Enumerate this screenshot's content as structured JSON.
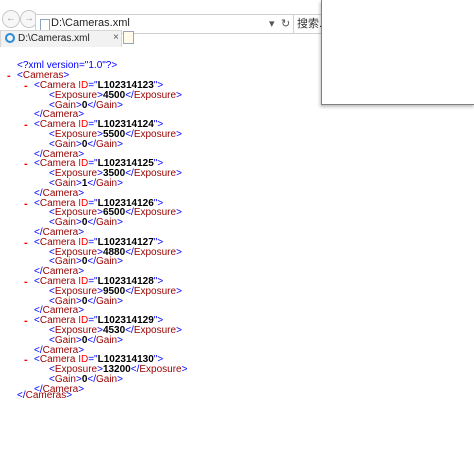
{
  "browser": {
    "address": "D:\\Cameras.xml",
    "search_label": "搜索...",
    "tab_title": "D:\\Cameras.xml",
    "tab_close": "×",
    "back_icon": "←",
    "forward_icon": "→",
    "search_icon": "▾",
    "refresh_icon": "↻",
    "stop_icon": "×"
  },
  "xml": {
    "declaration": "<?xml version=\"1.0\"?>",
    "root_open": "<Cameras>",
    "root_close": "</Cameras>",
    "cameras": [
      {
        "id": "L102314123",
        "exposure": "4500",
        "gain": "0"
      },
      {
        "id": "L102314124",
        "exposure": "5500",
        "gain": "0"
      },
      {
        "id": "L102314125",
        "exposure": "3500",
        "gain": "1"
      },
      {
        "id": "L102314126",
        "exposure": "6500",
        "gain": "0"
      },
      {
        "id": "L102314127",
        "exposure": "4880",
        "gain": "0"
      },
      {
        "id": "L102314128",
        "exposure": "9500",
        "gain": "0"
      },
      {
        "id": "L102314129",
        "exposure": "4530",
        "gain": "0"
      },
      {
        "id": "L102314130",
        "exposure": "13200",
        "gain": "0"
      }
    ]
  }
}
